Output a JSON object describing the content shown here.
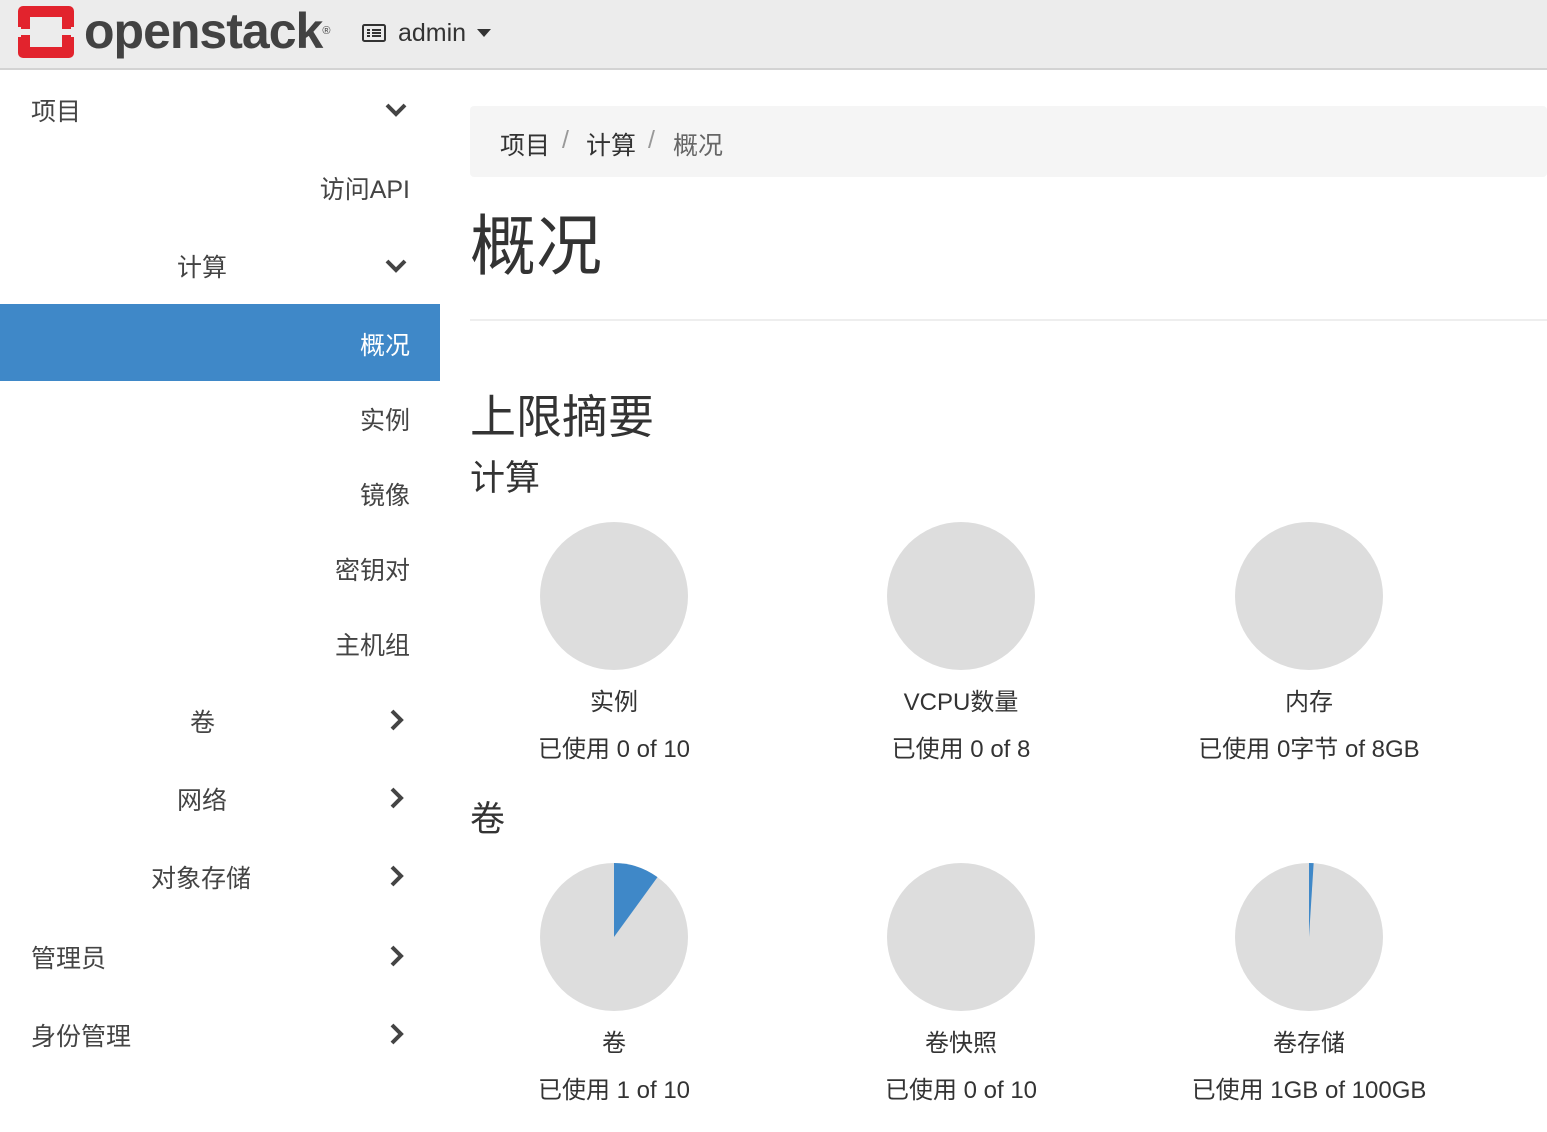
{
  "header": {
    "logo_text": "openstack",
    "logo_reg": "®",
    "project_name": "admin"
  },
  "colors": {
    "accent": "#3f88c8",
    "pie_bg": "#dddddd",
    "pie_fill": "#3f88c8"
  },
  "sidebar": {
    "items": [
      {
        "label": "项目",
        "chevron": "chevron-down-icon",
        "active": false
      },
      {
        "label": "访问API",
        "chevron": null,
        "active": false
      },
      {
        "label": "计算",
        "chevron": "chevron-down-icon",
        "active": false
      },
      {
        "label": "概况",
        "chevron": null,
        "active": true
      },
      {
        "label": "实例",
        "chevron": null,
        "active": false
      },
      {
        "label": "镜像",
        "chevron": null,
        "active": false
      },
      {
        "label": "密钥对",
        "chevron": null,
        "active": false
      },
      {
        "label": "主机组",
        "chevron": null,
        "active": false
      },
      {
        "label": "卷",
        "chevron": "chevron-right-icon",
        "active": false
      },
      {
        "label": "网络",
        "chevron": "chevron-right-icon",
        "active": false
      },
      {
        "label": "对象存储",
        "chevron": "chevron-right-icon",
        "active": false
      },
      {
        "label": "管理员",
        "chevron": "chevron-right-icon",
        "active": false
      },
      {
        "label": "身份管理",
        "chevron": "chevron-right-icon",
        "active": false
      }
    ]
  },
  "breadcrumb": [
    {
      "label": "项目"
    },
    {
      "label": "计算"
    },
    {
      "label": "概况"
    }
  ],
  "breadcrumb_separator": "/",
  "page_title": "概况",
  "limits_heading": "上限摘要",
  "sections": [
    {
      "heading": "计算",
      "charts": [
        {
          "title": "实例",
          "usage_text": "已使用 0 of 10",
          "used": 0,
          "total": 10
        },
        {
          "title": "VCPU数量",
          "usage_text": "已使用 0 of 8",
          "used": 0,
          "total": 8
        },
        {
          "title": "内存",
          "usage_text": "已使用 0字节 of 8GB",
          "used": 0,
          "total": 8
        }
      ]
    },
    {
      "heading": "卷",
      "charts": [
        {
          "title": "卷",
          "usage_text": "已使用 1 of 10",
          "used": 1,
          "total": 10
        },
        {
          "title": "卷快照",
          "usage_text": "已使用 0 of 10",
          "used": 0,
          "total": 10
        },
        {
          "title": "卷存储",
          "usage_text": "已使用 1GB of 100GB",
          "used": 1,
          "total": 100
        }
      ]
    }
  ]
}
